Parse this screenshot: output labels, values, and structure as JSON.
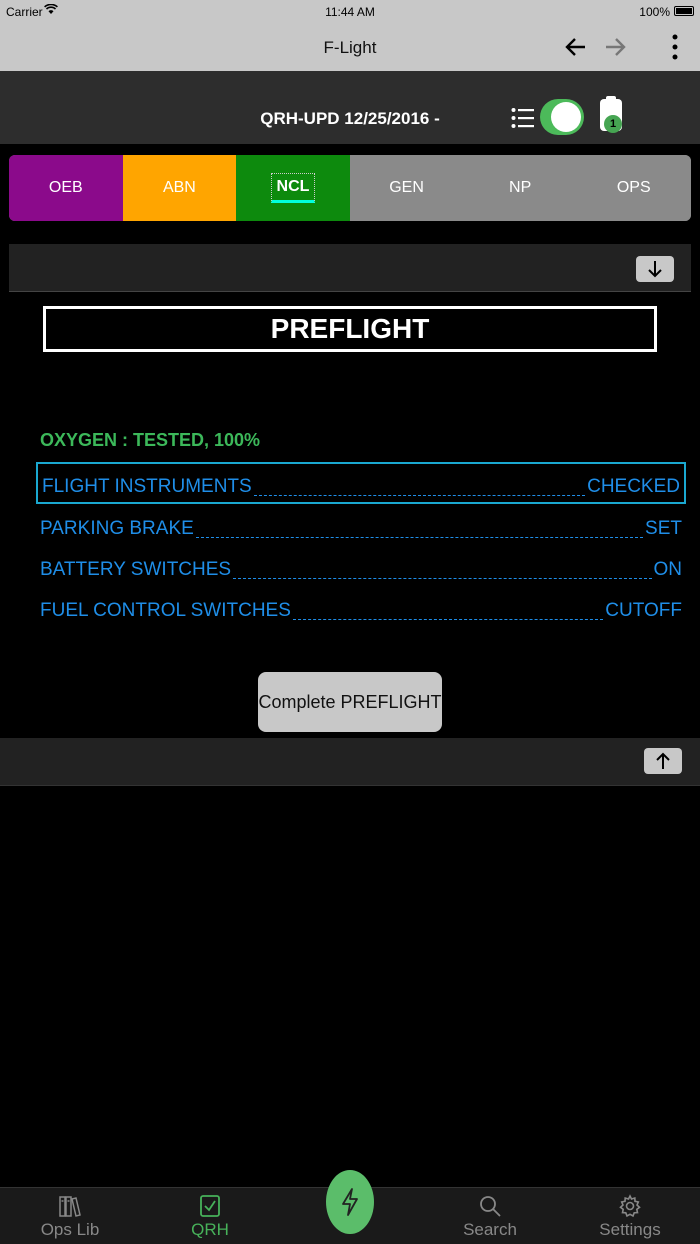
{
  "status_bar": {
    "carrier": "Carrier",
    "time": "11:44 AM",
    "battery": "100%"
  },
  "nav": {
    "title": "F-Light"
  },
  "header": {
    "document_title": "QRH-UPD 12/25/2016 -",
    "badge_count": "1",
    "toggle_on": true
  },
  "tabs": [
    {
      "label": "OEB",
      "color": "#8b0a8b"
    },
    {
      "label": "ABN",
      "color": "#ffa500"
    },
    {
      "label": "NCL",
      "color": "#0d8a0d",
      "selected": true
    },
    {
      "label": "GEN",
      "color": "#8a8a8a"
    },
    {
      "label": "NP",
      "color": "#8a8a8a"
    },
    {
      "label": "OPS",
      "color": "#8a8a8a"
    }
  ],
  "section": {
    "title": "PREFLIGHT",
    "note": "OXYGEN : TESTED, 100%",
    "items": [
      {
        "name": "FLIGHT INSTRUMENTS",
        "value": "CHECKED",
        "selected": true
      },
      {
        "name": "PARKING BRAKE",
        "value": "SET"
      },
      {
        "name": "BATTERY SWITCHES",
        "value": "ON"
      },
      {
        "name": "FUEL CONTROL SWITCHES",
        "value": "CUTOFF"
      }
    ],
    "complete_label": "Complete PREFLIGHT"
  },
  "tab_bar": {
    "items": [
      {
        "label": "Ops Lib",
        "icon": "book-icon"
      },
      {
        "label": "QRH",
        "icon": "checkbox-icon",
        "active": true
      },
      {
        "label": "Search",
        "icon": "search-icon"
      },
      {
        "label": "Settings",
        "icon": "gear-icon"
      }
    ],
    "center_icon": "lightning-icon"
  },
  "colors": {
    "accent": "#47b25a",
    "checklist_text": "#1f8ee8",
    "note_text": "#3cb85a"
  }
}
